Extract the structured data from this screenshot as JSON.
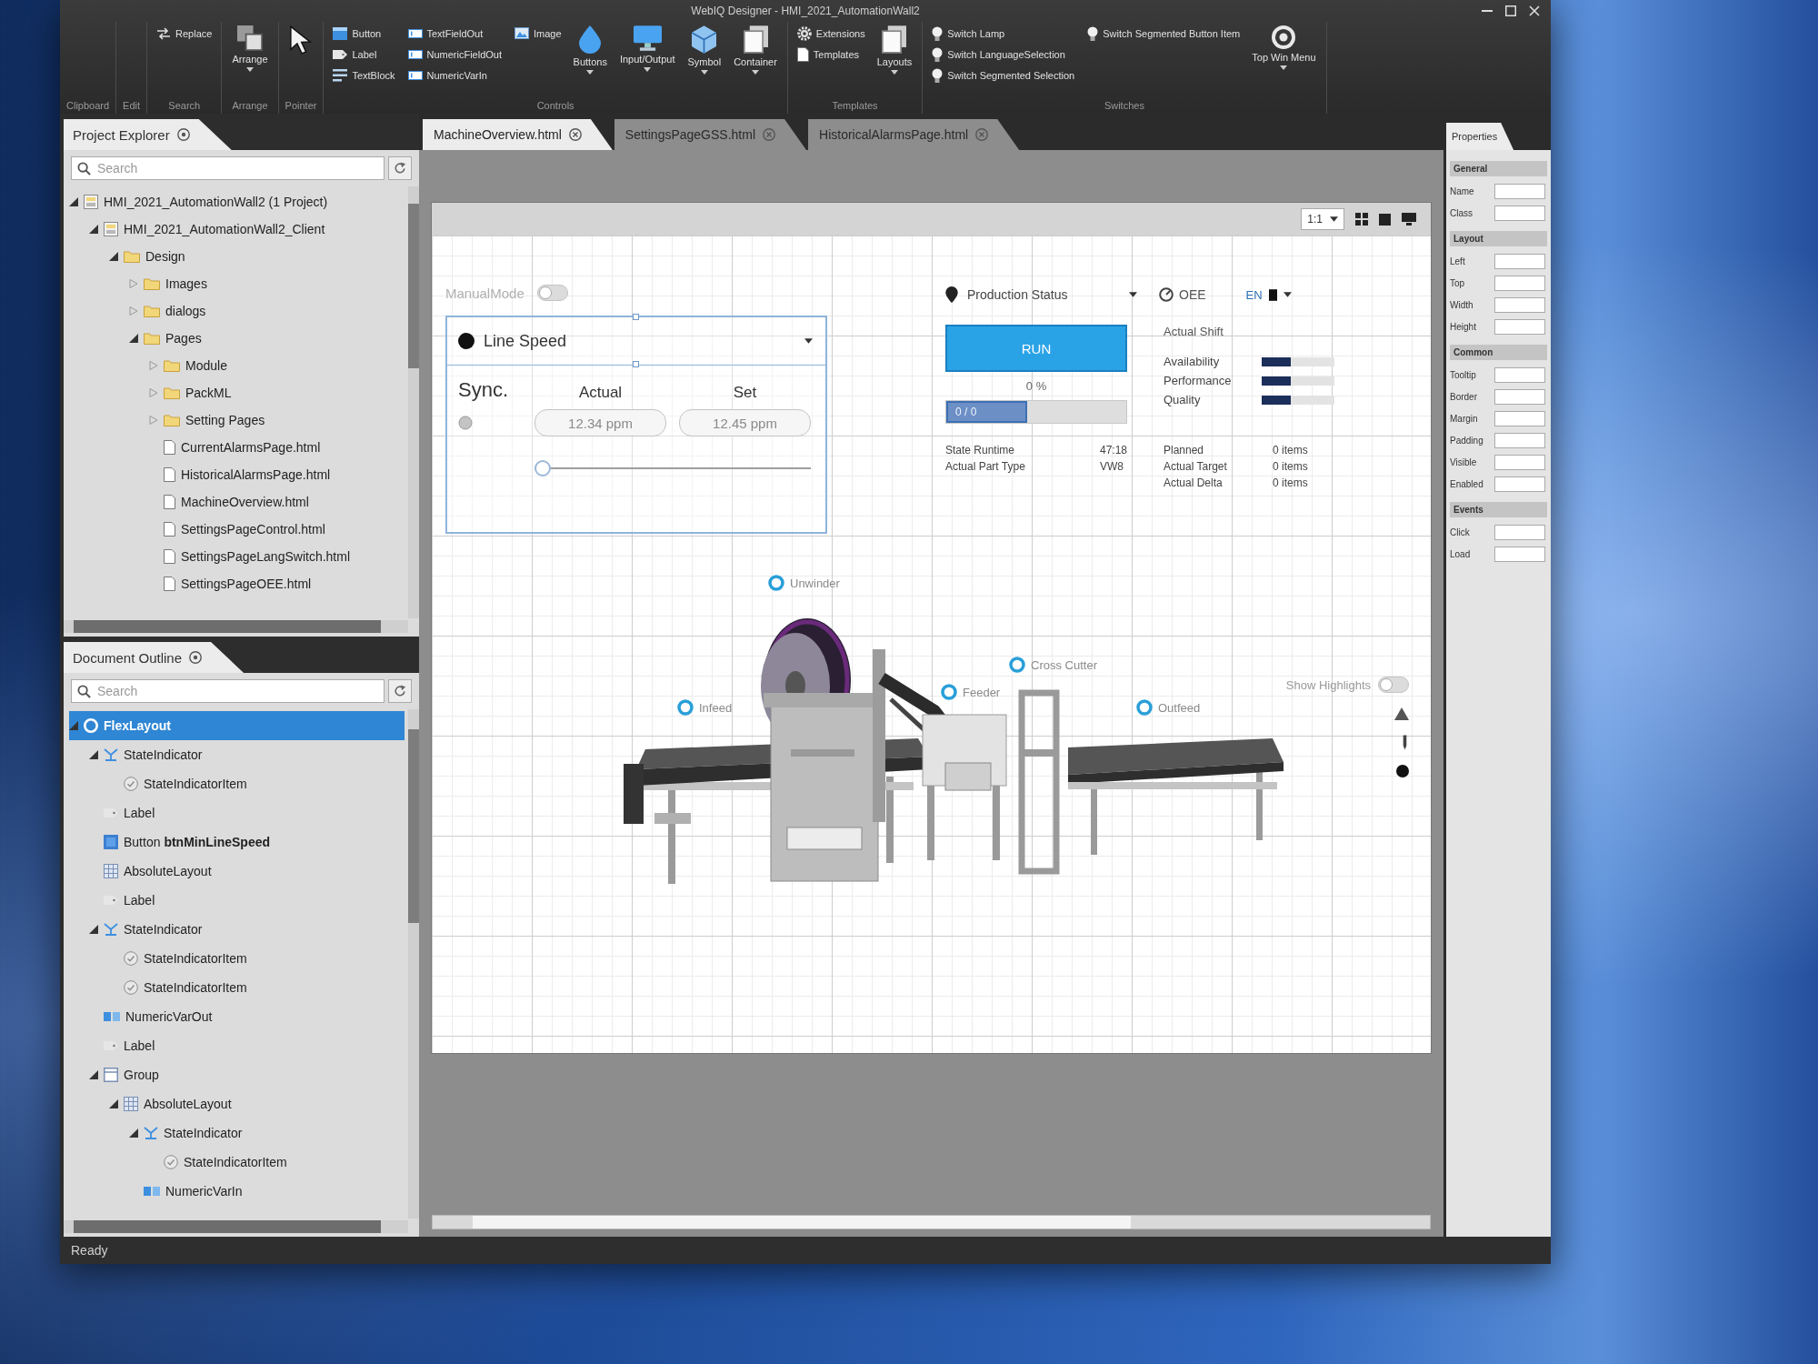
{
  "window": {
    "title": "WebIQ Designer - HMI_2021_AutomationWall2"
  },
  "ribbon": {
    "groups": [
      {
        "label": "Clipboard"
      },
      {
        "label": "Edit"
      },
      {
        "label": "Search",
        "items": [
          {
            "label": "Replace",
            "kind": "small"
          }
        ]
      },
      {
        "label": "Arrange",
        "items": [
          {
            "label": "Arrange",
            "kind": "large"
          }
        ]
      },
      {
        "label": "Pointer",
        "items": [
          {
            "kind": "large"
          }
        ]
      },
      {
        "label": "Controls",
        "items": [
          {
            "label": "Button",
            "kind": "small"
          },
          {
            "label": "Label",
            "kind": "small"
          },
          {
            "label": "TextBlock",
            "kind": "small"
          },
          {
            "label": "TextFieldOut",
            "kind": "small"
          },
          {
            "label": "NumericFieldOut",
            "kind": "small"
          },
          {
            "label": "NumericVarIn",
            "kind": "small"
          },
          {
            "label": "Image",
            "kind": "small"
          },
          {
            "label": "Buttons",
            "kind": "large"
          },
          {
            "label": "Input/Output",
            "kind": "large"
          },
          {
            "label": "Symbol",
            "kind": "large"
          },
          {
            "label": "Container",
            "kind": "large"
          }
        ]
      },
      {
        "label": "Templates",
        "items": [
          {
            "label": "Extensions",
            "kind": "small"
          },
          {
            "label": "Templates",
            "kind": "small"
          },
          {
            "label": "Layouts",
            "kind": "large"
          }
        ]
      },
      {
        "label": "Switches",
        "items": [
          {
            "label": "Switch Lamp",
            "kind": "small"
          },
          {
            "label": "Switch LanguageSelection",
            "kind": "small"
          },
          {
            "label": "Switch Segmented Selection",
            "kind": "small"
          },
          {
            "label": "Switch Segmented Button Item",
            "kind": "small"
          },
          {
            "label": "Top Win Menu",
            "kind": "large"
          }
        ]
      }
    ]
  },
  "document_tabs": [
    {
      "label": "MachineOverview.html",
      "selected": true
    },
    {
      "label": "SettingsPageGSS.html",
      "selected": false
    },
    {
      "label": "HistoricalAlarmsPage.html",
      "selected": false
    }
  ],
  "project_explorer": {
    "title": "Project Explorer",
    "search": {
      "placeholder": "Search"
    },
    "tree": [
      {
        "label": "HMI_2021_AutomationWall2 (1 Project)",
        "kind": "solution",
        "expanded": true,
        "children": [
          {
            "label": "HMI_2021_AutomationWall2_Client",
            "kind": "project",
            "expanded": true,
            "children": [
              {
                "label": "Design",
                "kind": "folder",
                "expanded": true,
                "children": [
                  {
                    "label": "Images",
                    "kind": "folder",
                    "expanded": false
                  },
                  {
                    "label": "dialogs",
                    "kind": "folder",
                    "expanded": false
                  },
                  {
                    "label": "Pages",
                    "kind": "folder",
                    "expanded": true,
                    "children": [
                      {
                        "label": "Module",
                        "kind": "folder",
                        "expanded": false
                      },
                      {
                        "label": "PackML",
                        "kind": "folder",
                        "expanded": false
                      },
                      {
                        "label": "Setting Pages",
                        "kind": "folder",
                        "expanded": false
                      },
                      {
                        "label": "CurrentAlarmsPage.html",
                        "kind": "page"
                      },
                      {
                        "label": "HistoricalAlarmsPage.html",
                        "kind": "page"
                      },
                      {
                        "label": "MachineOverview.html",
                        "kind": "page"
                      },
                      {
                        "label": "SettingsPageControl.html",
                        "kind": "page"
                      },
                      {
                        "label": "SettingsPageLangSwitch.html",
                        "kind": "page"
                      },
                      {
                        "label": "SettingsPageOEE.html",
                        "kind": "page"
                      }
                    ]
                  }
                ]
              }
            ]
          }
        ]
      }
    ]
  },
  "document_outline": {
    "title": "Document Outline",
    "search": {
      "placeholder": "Search"
    },
    "tree": [
      {
        "label": "FlexLayout",
        "kind": "flex-layout",
        "selected": true,
        "expanded": true,
        "children": [
          {
            "label": "StateIndicator",
            "kind": "state-indicator",
            "selected": false,
            "expanded": true,
            "children": [
              {
                "label": "StateIndicatorItem",
                "kind": "state-indicator-item",
                "selected": false
              }
            ]
          },
          {
            "label": "Label",
            "kind": "label",
            "selected": false
          },
          {
            "label": "Button **btnMinLineSpeed**",
            "kind": "button",
            "selected": false
          },
          {
            "label": "AbsoluteLayout",
            "kind": "absolute-layout",
            "selected": false
          },
          {
            "label": "Label",
            "kind": "label",
            "selected": false
          },
          {
            "label": "StateIndicator",
            "kind": "state-indicator",
            "selected": false,
            "expanded": true,
            "children": [
              {
                "label": "StateIndicatorItem",
                "kind": "state-indicator-item",
                "selected": false
              },
              {
                "label": "StateIndicatorItem",
                "kind": "state-indicator-item",
                "selected": false
              }
            ]
          },
          {
            "label": "NumericVarOut",
            "kind": "numeric-var-out",
            "selected": false
          },
          {
            "label": "Label",
            "kind": "label",
            "selected": false
          },
          {
            "label": "Group",
            "kind": "group",
            "selected": false,
            "expanded": true,
            "children": [
              {
                "label": "AbsoluteLayout",
                "kind": "absolute-layout",
                "selected": false,
                "expanded": true,
                "children": [
                  {
                    "label": "StateIndicator",
                    "kind": "state-indicator",
                    "selected": false,
                    "expanded": true,
                    "children": [
                      {
                        "label": "StateIndicatorItem",
                        "kind": "state-indicator-item",
                        "selected": false
                      }
                    ]
                  },
                  {
                    "label": "NumericVarIn",
                    "kind": "numeric-var-in",
                    "selected": false
                  }
                ]
              }
            ]
          }
        ]
      }
    ]
  },
  "canvas": {
    "zoom": "1:1",
    "manual_mode": {
      "label": "ManualMode",
      "on": false,
      "disabled": true
    },
    "line_speed": {
      "title": "Line Speed",
      "selected": true,
      "sync_label": "Sync.",
      "sync_on": false,
      "actual_label": "Actual",
      "set_label": "Set",
      "actual_value": "12.34 ppm",
      "set_value": "12.45 ppm",
      "slider": {
        "level": 0
      }
    },
    "production": {
      "title": "Production Status",
      "oee": "OEE",
      "language": "EN",
      "state": "RUN",
      "percent": "0 %",
      "progress": {
        "level": 0.45,
        "label": "0 / 0"
      }
    },
    "shift": {
      "title": "Actual Shift",
      "metrics": [
        {
          "label": "Availability",
          "level": 0.4
        },
        {
          "label": "Performance",
          "level": 0.4
        },
        {
          "label": "Quality",
          "level": 0.4
        }
      ]
    },
    "details_left": [
      {
        "label": "State Runtime",
        "value": "47:18"
      },
      {
        "label": "Actual Part Type",
        "value": "VW8"
      }
    ],
    "details_right": [
      {
        "label": "Planned",
        "value": "0 items"
      },
      {
        "label": "Actual Target",
        "value": "0 items"
      },
      {
        "label": "Actual Delta",
        "value": "0 items"
      }
    ],
    "stations": [
      {
        "label": "Unwinder"
      },
      {
        "label": "Infeed"
      },
      {
        "label": "Feeder"
      },
      {
        "label": "Cross Cutter"
      },
      {
        "label": "Outfeed"
      }
    ],
    "highlight": {
      "label": "Show Highlights",
      "on": false
    }
  },
  "properties": {
    "title": "Properties",
    "sections": [
      {
        "title": "General",
        "rows": [
          {
            "label": "Name"
          },
          {
            "label": "Class"
          }
        ]
      },
      {
        "title": "Layout",
        "rows": [
          {
            "label": "Left"
          },
          {
            "label": "Top"
          },
          {
            "label": "Width"
          },
          {
            "label": "Height"
          }
        ]
      },
      {
        "title": "Common",
        "rows": [
          {
            "label": "Tooltip"
          },
          {
            "label": "Border"
          },
          {
            "label": "Margin"
          },
          {
            "label": "Padding"
          },
          {
            "label": "Visible"
          },
          {
            "label": "Enabled"
          }
        ]
      },
      {
        "title": "Events",
        "rows": [
          {
            "label": "Click"
          },
          {
            "label": "Load"
          }
        ]
      }
    ]
  },
  "status_bar": {
    "text": "Ready"
  }
}
